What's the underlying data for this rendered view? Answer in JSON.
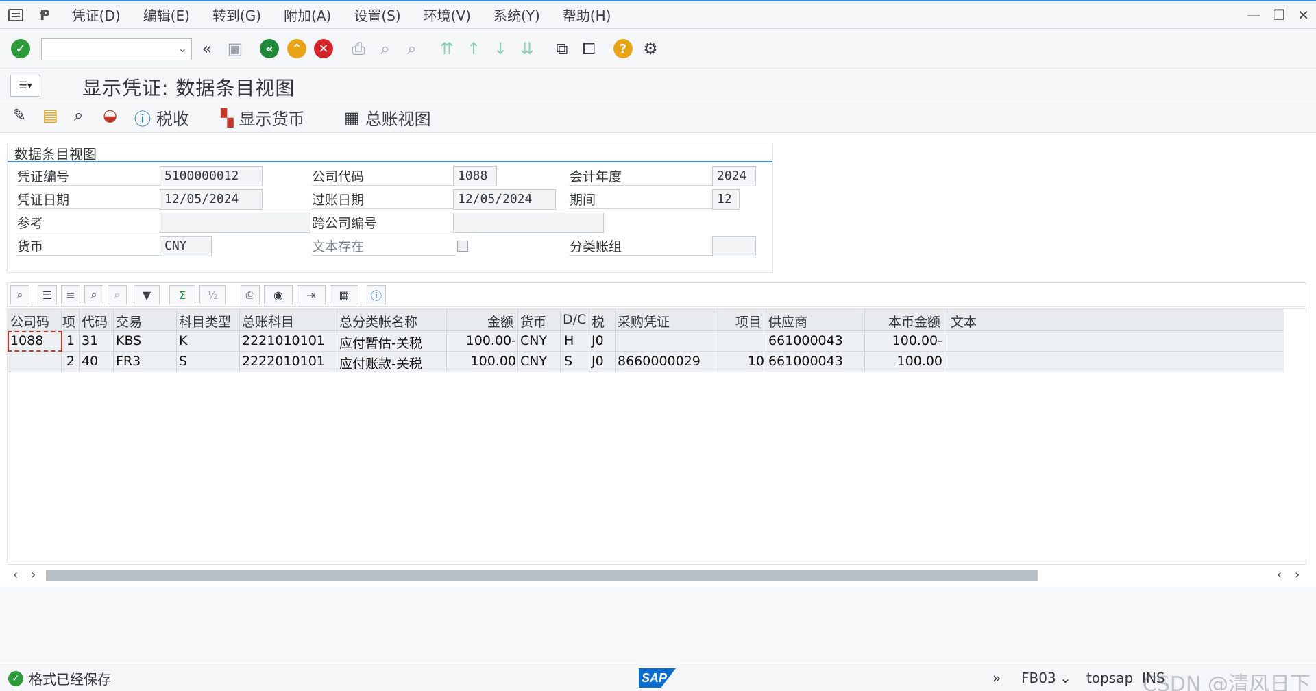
{
  "menu": {
    "items": [
      "凭证(D)",
      "编辑(E)",
      "转到(G)",
      "附加(A)",
      "设置(S)",
      "环境(V)",
      "系统(Y)",
      "帮助(H)"
    ]
  },
  "title": "显示凭证: 数据条目视图",
  "app_toolbar": {
    "tax": "税收",
    "show_currency": "显示货币",
    "gl_view": "总账视图"
  },
  "header_group": {
    "title": "数据条目视图",
    "fields": {
      "doc_no_label": "凭证编号",
      "doc_no": "5100000012",
      "company_label": "公司代码",
      "company": "1088",
      "fiscal_year_label": "会计年度",
      "fiscal_year": "2024",
      "doc_date_label": "凭证日期",
      "doc_date": "12/05/2024",
      "post_date_label": "过账日期",
      "post_date": "12/05/2024",
      "period_label": "期间",
      "period": "12",
      "ref_label": "参考",
      "ref": "",
      "cross_company_label": "跨公司编号",
      "cross_company": "",
      "currency_label": "货币",
      "currency": "CNY",
      "text_exists_label": "文本存在",
      "ledger_group_label": "分类账组",
      "ledger_group": ""
    }
  },
  "grid": {
    "columns": [
      "公司码",
      "项",
      "代码",
      "交易",
      "科目类型",
      "总账科目",
      "总分类帐名称",
      "金额",
      "货币",
      "D/C",
      "税",
      "采购凭证",
      "项目",
      "供应商",
      "本币金额",
      "文本"
    ],
    "rows": [
      [
        "1088",
        "1",
        "31",
        "KBS",
        "K",
        "2221010101",
        "应付暂估-关税",
        "100.00-",
        "CNY",
        "H",
        "J0",
        "",
        "",
        "661000043",
        "100.00-",
        ""
      ],
      [
        "",
        "2",
        "40",
        "FR3",
        "S",
        "2222010101",
        "应付账款-关税",
        "100.00",
        "CNY",
        "S",
        "J0",
        "8660000029",
        "10",
        "661000043",
        "100.00",
        ""
      ]
    ]
  },
  "status": {
    "message": "格式已经保存",
    "tcode": "FB03",
    "system": "topsap",
    "mode": "INS"
  },
  "watermark": "CSDN @清风日下",
  "colors": {
    "accent": "#3a8fd8",
    "ok_green": "#2e9b3a",
    "back_green": "#1e8a3a",
    "exit_orange": "#e8a317",
    "cancel_red": "#d6232a"
  }
}
